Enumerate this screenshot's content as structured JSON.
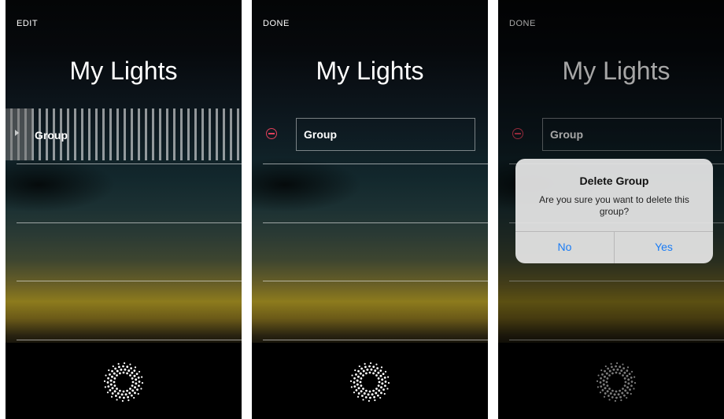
{
  "screens": [
    {
      "top_button": "EDIT",
      "title": "My Lights",
      "row_label": "Group"
    },
    {
      "top_button": "DONE",
      "title": "My Lights",
      "row_label": "Group"
    },
    {
      "top_button": "DONE",
      "title": "My Lights",
      "row_label": "Group"
    }
  ],
  "dialog": {
    "title": "Delete Group",
    "message": "Are you sure you want to delete this group?",
    "no_label": "No",
    "yes_label": "Yes"
  },
  "colors": {
    "delete_accent": "#e0405a",
    "dialog_button": "#1a7cf5"
  },
  "icons": {
    "arrow": "disclosure-arrow-icon",
    "minus": "delete-minus-icon",
    "sun": "sun-icon"
  }
}
